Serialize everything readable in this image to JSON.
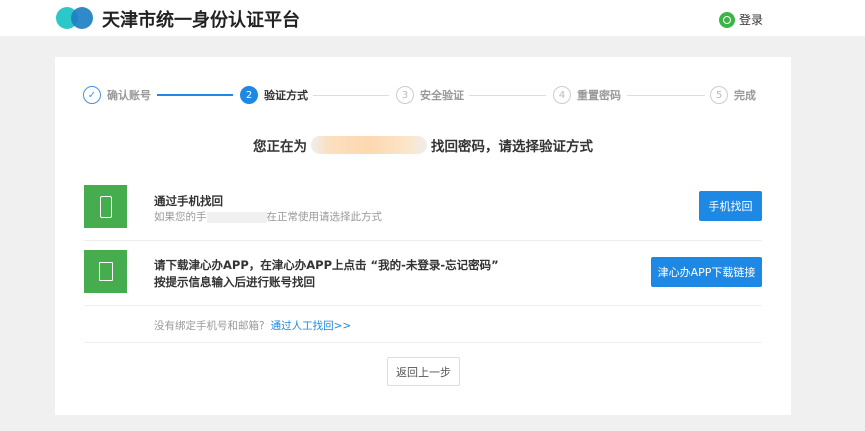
{
  "header": {
    "title": "天津市统一身份认证平台",
    "login_label": "登录"
  },
  "steps": [
    {
      "num": "✓",
      "label": "确认账号",
      "state": "done"
    },
    {
      "num": "2",
      "label": "验证方式",
      "state": "active"
    },
    {
      "num": "3",
      "label": "安全验证",
      "state": "pending"
    },
    {
      "num": "4",
      "label": "重置密码",
      "state": "pending"
    },
    {
      "num": "5",
      "label": "完成",
      "state": "pending"
    }
  ],
  "heading": {
    "prefix": "您正在为",
    "suffix": "找回密码，请选择验证方式"
  },
  "options": [
    {
      "title": "通过手机找回",
      "subtitle_prefix": "如果您的手",
      "subtitle_suffix": "在正常使用请选择此方式",
      "button": "手机找回",
      "icon": "phone-icon"
    },
    {
      "title_line1": "请下载津心办APP，在津心办APP上点击 “我的-未登录-忘记密码”",
      "title_line2": "按提示信息输入后进行账号找回",
      "button": "津心办APP下载链接",
      "icon": "document-icon"
    }
  ],
  "hint": {
    "text": "没有绑定手机号和邮箱?",
    "link": "通过人工找回>>"
  },
  "back_label": "返回上一步",
  "colors": {
    "accent": "#1e88e5",
    "icon_green": "#46ad4f"
  }
}
